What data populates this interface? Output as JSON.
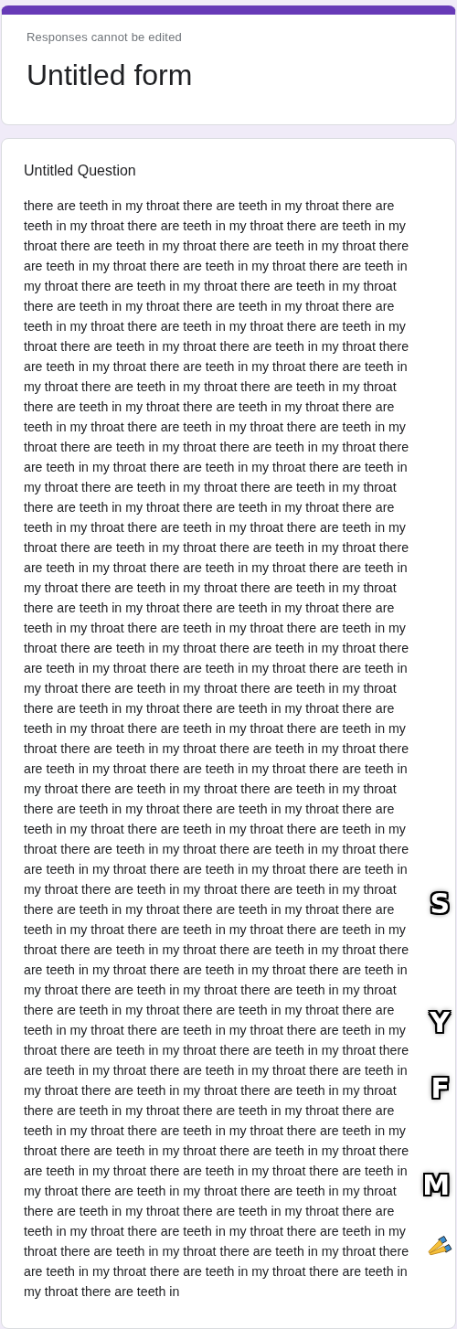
{
  "header": {
    "notice": "Responses cannot be edited",
    "title": "Untitled form"
  },
  "question": {
    "title": "Untitled Question",
    "answer": "there are teeth in my throat there are teeth in my throat there are teeth in my throat there are teeth in my throat there are teeth in my throat there are teeth in my throat there are teeth in my throat there are teeth in my throat there are teeth in my throat there are teeth in my throat there are teeth in my throat there are teeth in my throat there are teeth in my throat there are teeth in my throat there are teeth in my throat there are teeth in my throat there are teeth in my throat there are teeth in my throat there are teeth in my throat there are teeth in my throat there are teeth in my throat there are teeth in my throat there are teeth in my throat there are teeth in my throat there are teeth in my throat there are teeth in my throat there are teeth in my throat there are teeth in my throat there are teeth in my throat there are teeth in my throat there are teeth in my throat there are teeth in my throat there are teeth in my throat there are teeth in my throat there are teeth in my throat there are teeth in my throat there are teeth in my throat there are teeth in my throat there are teeth in my throat there are teeth in my throat there are teeth in my throat there are teeth in my throat there are teeth in my throat there are teeth in my throat there are teeth in my throat there are teeth in my throat there are teeth in my throat there are teeth in my throat there are teeth in my throat there are teeth in my throat there are teeth in my throat there are teeth in my throat there are teeth in my throat there are teeth in my throat there are teeth in my throat there are teeth in my throat there are teeth in my throat there are teeth in my throat there are teeth in my throat there are teeth in my throat there are teeth in my throat there are teeth in my throat there are teeth in my throat there are teeth in my throat there are teeth in my throat there are teeth in my throat there are teeth in my throat there are teeth in my throat there are teeth in my throat there are teeth in my throat there are teeth in my throat there are teeth in my throat there are teeth in my throat there are teeth in my throat there are teeth in my throat there are teeth in my throat there are teeth in my throat there are teeth in my throat there are teeth in my throat there are teeth in my throat there are teeth in my throat there are teeth in my throat there are teeth in my throat there are teeth in my throat there are teeth in my throat there are teeth in my throat there are teeth in my throat there are teeth in my throat there are teeth in my throat there are teeth in my throat there are teeth in my throat there are teeth in my throat there are teeth in my throat there are teeth in my throat there are teeth in my throat there are teeth in my throat there are teeth in my throat there are teeth in my throat there are teeth in my throat there are teeth in my throat there are teeth in my throat there are teeth in my throat there are teeth in my throat there are teeth in my throat there are teeth in my throat there are teeth in my throat there are teeth in my throat there are teeth in my throat there are teeth in my throat there are teeth in my throat there are teeth in my throat there are teeth in my throat there are teeth in my throat there are teeth in my throat there are teeth in my throat there are teeth in my throat there are teeth in my throat there are teeth in my throat there are teeth in my throat there are teeth in my throat there are teeth in my throat there are teeth in my throat there are teeth in my throat there are teeth in my throat there are teeth in my throat there are teeth in my throat there are teeth in my throat there are teeth in my throat there are teeth in my throat there are teeth in my throat there are teeth in"
  },
  "overlay": {
    "letters": [
      "S",
      "Y",
      "F",
      "M"
    ]
  }
}
